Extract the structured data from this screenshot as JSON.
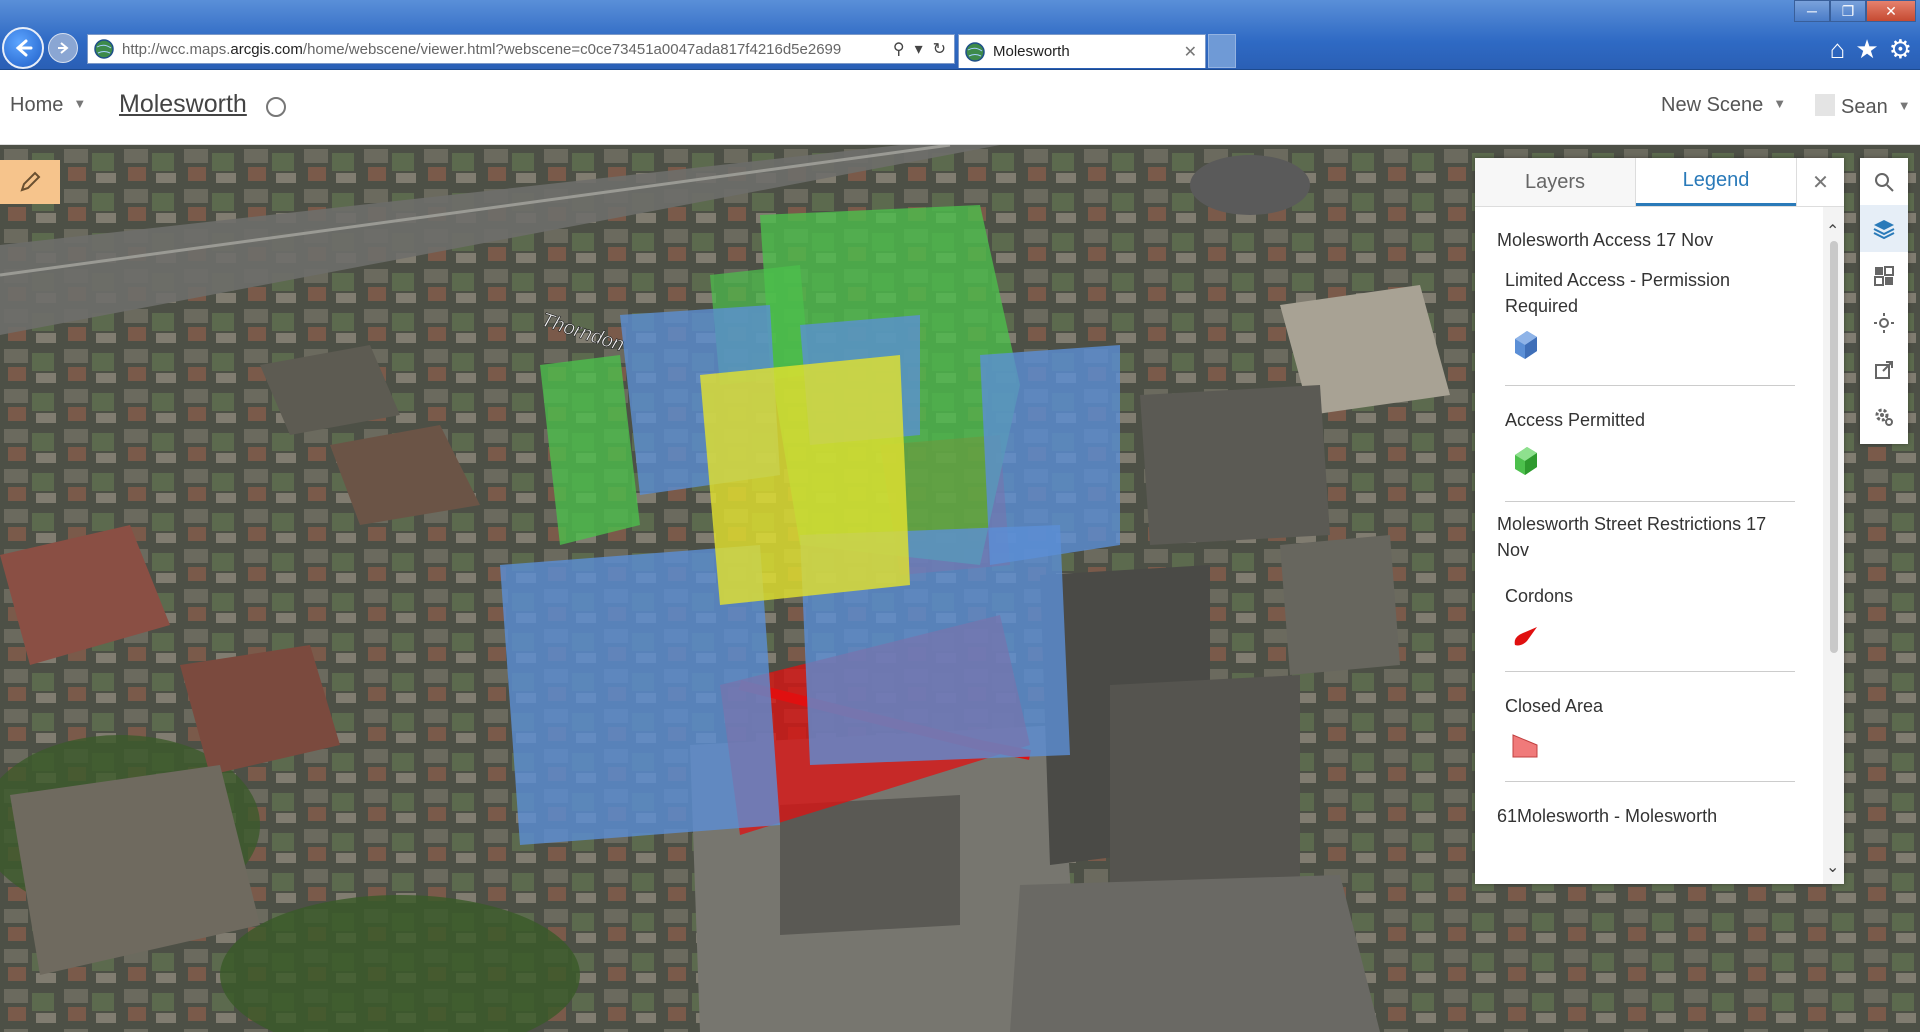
{
  "browser": {
    "url_prefix": "http://wcc.maps.",
    "url_domain": "arcgis.com",
    "url_rest": "/home/webscene/viewer.html?webscene=c0ce73451a0047ada817f4216d5e2699",
    "tab_title": "Molesworth"
  },
  "header": {
    "home_label": "Home",
    "scene_title": "Molesworth",
    "new_scene_label": "New Scene",
    "user_name": "Sean"
  },
  "map_labels": {
    "street_label": "Thorndon"
  },
  "panel": {
    "tab_layers": "Layers",
    "tab_legend": "Legend",
    "layer1_title": "Molesworth Access 17 Nov",
    "item_limited": "Limited Access - Permission Required",
    "item_permitted": "Access Permitted",
    "layer2_title": "Molesworth Street Restrictions 17 Nov",
    "item_cordons": "Cordons",
    "item_closed": "Closed Area",
    "layer3_title_partial": "61Molesworth - Molesworth"
  },
  "colors": {
    "limited_access": "#5b8fd6",
    "access_permitted": "#4cc04c",
    "cordons": "#e01010",
    "closed_area": "#f07a7a",
    "accent": "#2a7ab9"
  }
}
